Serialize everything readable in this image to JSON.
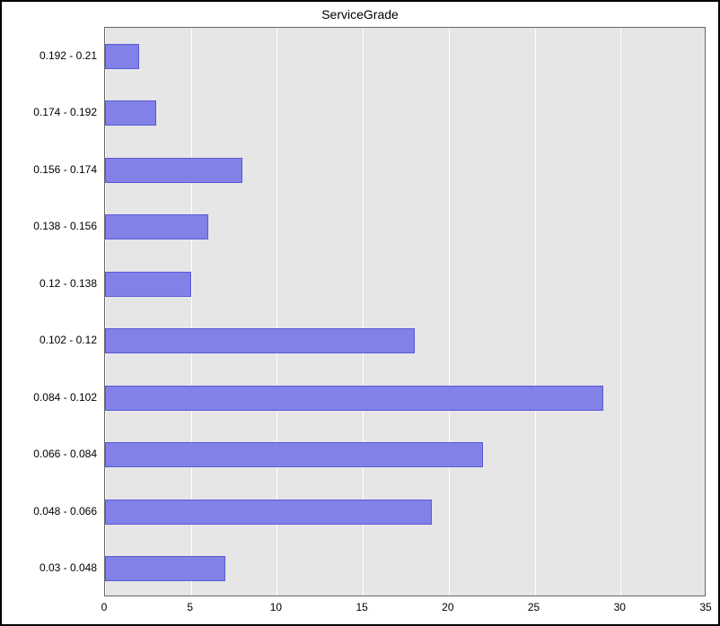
{
  "chart_data": {
    "type": "bar",
    "orientation": "horizontal",
    "title": "ServiceGrade",
    "categories": [
      "0.192 - 0.21",
      "0.174 - 0.192",
      "0.156 - 0.174",
      "0.138 - 0.156",
      "0.12 - 0.138",
      "0.102 - 0.12",
      "0.084 - 0.102",
      "0.066 - 0.084",
      "0.048 - 0.066",
      "0.03 - 0.048"
    ],
    "values": [
      2,
      3,
      8,
      6,
      5,
      18,
      29,
      22,
      19,
      7
    ],
    "xlabel": "",
    "ylabel": "",
    "xlim": [
      0,
      35
    ],
    "x_ticks": [
      0,
      5,
      10,
      15,
      20,
      25,
      30,
      35
    ],
    "grid": true,
    "bar_color": "#8181e8",
    "plot_bg": "#e6e6e6"
  }
}
